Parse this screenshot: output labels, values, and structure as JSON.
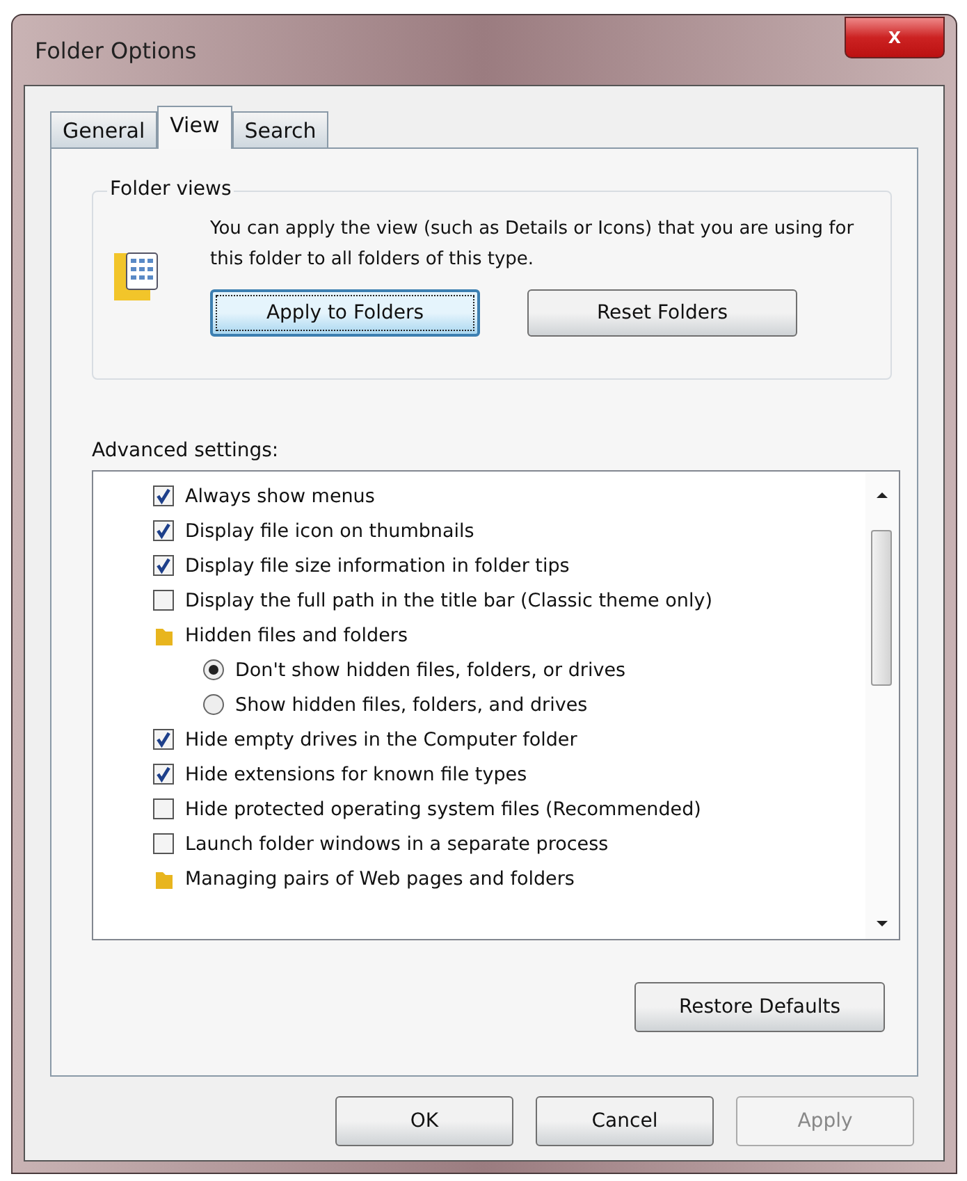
{
  "window": {
    "title": "Folder Options",
    "close": "x"
  },
  "tabs": [
    {
      "label": "General",
      "selected": false
    },
    {
      "label": "View",
      "selected": true
    },
    {
      "label": "Search",
      "selected": false
    }
  ],
  "folder_views": {
    "title": "Folder views",
    "description": "You can apply the view (such as Details or Icons) that you are using for this folder to all folders of this type.",
    "buttons": [
      {
        "label": "Apply to Folders",
        "focused": true
      },
      {
        "label": "Reset Folders",
        "focused": false
      }
    ]
  },
  "advanced": {
    "label": "Advanced settings:",
    "items": [
      {
        "kind": "checkbox",
        "label": "Always show menus",
        "checked": true
      },
      {
        "kind": "checkbox",
        "label": "Display file icon on thumbnails",
        "checked": true
      },
      {
        "kind": "checkbox",
        "label": "Display file size information in folder tips",
        "checked": true
      },
      {
        "kind": "checkbox",
        "label": "Display the full path in the title bar (Classic theme only)",
        "checked": false
      },
      {
        "kind": "folder",
        "label": "Hidden files and folders"
      },
      {
        "kind": "radio",
        "label": "Don't show hidden files, folders, or drives",
        "selected": true
      },
      {
        "kind": "radio",
        "label": "Show hidden files, folders, and drives",
        "selected": false
      },
      {
        "kind": "checkbox",
        "label": "Hide empty drives in the Computer folder",
        "checked": true
      },
      {
        "kind": "checkbox",
        "label": "Hide extensions for known file types",
        "checked": true
      },
      {
        "kind": "checkbox",
        "label": "Hide protected operating system files (Recommended)",
        "checked": false
      },
      {
        "kind": "checkbox",
        "label": "Launch folder windows in a separate process",
        "checked": false
      },
      {
        "kind": "folder",
        "label": "Managing pairs of Web pages and folders"
      }
    ]
  },
  "restore_button": "Restore Defaults",
  "footer_buttons": [
    {
      "label": "OK",
      "disabled": false
    },
    {
      "label": "Cancel",
      "disabled": false
    },
    {
      "label": "Apply",
      "disabled": true
    }
  ]
}
